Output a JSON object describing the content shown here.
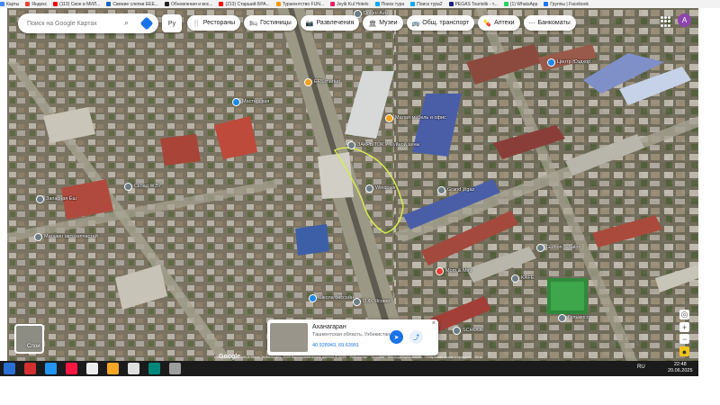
{
  "bookmarks": [
    {
      "label": "Карты",
      "color": "#4285f4"
    },
    {
      "label": "Яндекс",
      "color": "#f44336"
    },
    {
      "label": "(113) Свое и МИЛ...",
      "color": "#ff0000"
    },
    {
      "label": "Свежие слепки ЕЕЕ...",
      "color": "#1565c0"
    },
    {
      "label": "Обновления и вос...",
      "color": "#222222"
    },
    {
      "label": "(213) Старший БРА...",
      "color": "#ff0000"
    },
    {
      "label": "Турагентство FUN...",
      "color": "#ff9800"
    },
    {
      "label": "Jeyik Kul Hotels",
      "color": "#e91e63"
    },
    {
      "label": "Поиск тура",
      "color": "#03a9f4"
    },
    {
      "label": "Поиск тура2",
      "color": "#03a9f4"
    },
    {
      "label": "PEGAS Touristik - т...",
      "color": "#1a237e"
    },
    {
      "label": "(1) WhatsApp",
      "color": "#25d366"
    },
    {
      "label": "Группы | Facebook",
      "color": "#1877f2"
    }
  ],
  "search": {
    "placeholder": "Поиск на Google Картах"
  },
  "lang_button": "Ру",
  "categories": [
    {
      "icon": "fork-knife-icon",
      "glyph": "🍴",
      "label": "Рестораны"
    },
    {
      "icon": "bed-icon",
      "glyph": "🛏",
      "label": "Гостиницы"
    },
    {
      "icon": "camera-icon",
      "glyph": "📷",
      "label": "Развлечения"
    },
    {
      "icon": "museum-icon",
      "glyph": "🏛",
      "label": "Музеи"
    },
    {
      "icon": "bus-icon",
      "glyph": "🚌",
      "label": "Общ. транспорт"
    },
    {
      "icon": "pharmacy-icon",
      "glyph": "💊",
      "label": "Аптеки"
    },
    {
      "icon": "atm-icon",
      "glyph": "⋯",
      "label": "Банкоматы"
    }
  ],
  "avatar_letter": "A",
  "place_labels": [
    {
      "text": "Dolgor Aziz",
      "pin": "grey"
    },
    {
      "text": "EFS market",
      "pin": "orange"
    },
    {
      "text": "Мастерская",
      "pin": "blue"
    },
    {
      "text": "Малая мебель и офис",
      "pin": "orange"
    },
    {
      "text": "ЗАКРЫТОК У Суйной цены",
      "pin": "grey"
    },
    {
      "text": "Windows",
      "pin": "grey"
    },
    {
      "text": "Grand Yigaz",
      "pin": "grey"
    },
    {
      "text": "Центр Юздхор",
      "pin": "blue"
    },
    {
      "text": "Запасная Ёш",
      "pin": "grey"
    },
    {
      "text": "Склад ЖЭУ",
      "pin": "grey"
    },
    {
      "text": "Магазин автозапчастей",
      "pin": "grey"
    },
    {
      "text": "Gulhon S Salon",
      "pin": "grey"
    },
    {
      "text": "Mom & Mini",
      "pin": "red"
    },
    {
      "text": "KAFE",
      "pin": "grey"
    },
    {
      "text": "Школа бассейн",
      "pin": "blue"
    },
    {
      "text": "О.Ф. Ясовет",
      "pin": "grey"
    },
    {
      "text": "SCHOOL",
      "pin": "grey"
    },
    {
      "text": "Гульмосс",
      "pin": "grey"
    }
  ],
  "layers_label": "Слои",
  "info_card": {
    "title": "Аханагаран",
    "subtitle": "Ташкентская область, Узбекистан",
    "coords": "40.928943, 69.63991",
    "close": "×"
  },
  "footer": {
    "text": "Изображения © Airbus,Maxar Technologies, 2025 Картографические данные © 2025",
    "links": [
      "Узбекистан",
      "Условия",
      "Конфиденциальность",
      "Отправить отзыв о продукте",
      "50 м"
    ]
  },
  "google_logo": "Google",
  "taskbar": {
    "lang": "RU",
    "time": "22:48",
    "date": "20.06.2025",
    "apps": [
      {
        "icon": "start-icon",
        "color": "#2a6fd6"
      },
      {
        "icon": "acrobat-icon",
        "color": "#d32f2f"
      },
      {
        "icon": "ie-icon",
        "color": "#2196f3"
      },
      {
        "icon": "opera-icon",
        "color": "#ff1744"
      },
      {
        "icon": "media-player-icon",
        "color": "#eeeeee"
      },
      {
        "icon": "explorer-icon",
        "color": "#f9a825"
      },
      {
        "icon": "word-icon",
        "color": "#e0e0e0"
      },
      {
        "icon": "edge-icon",
        "color": "#00897b"
      },
      {
        "icon": "settings-icon",
        "color": "#9e9e9e"
      }
    ]
  }
}
